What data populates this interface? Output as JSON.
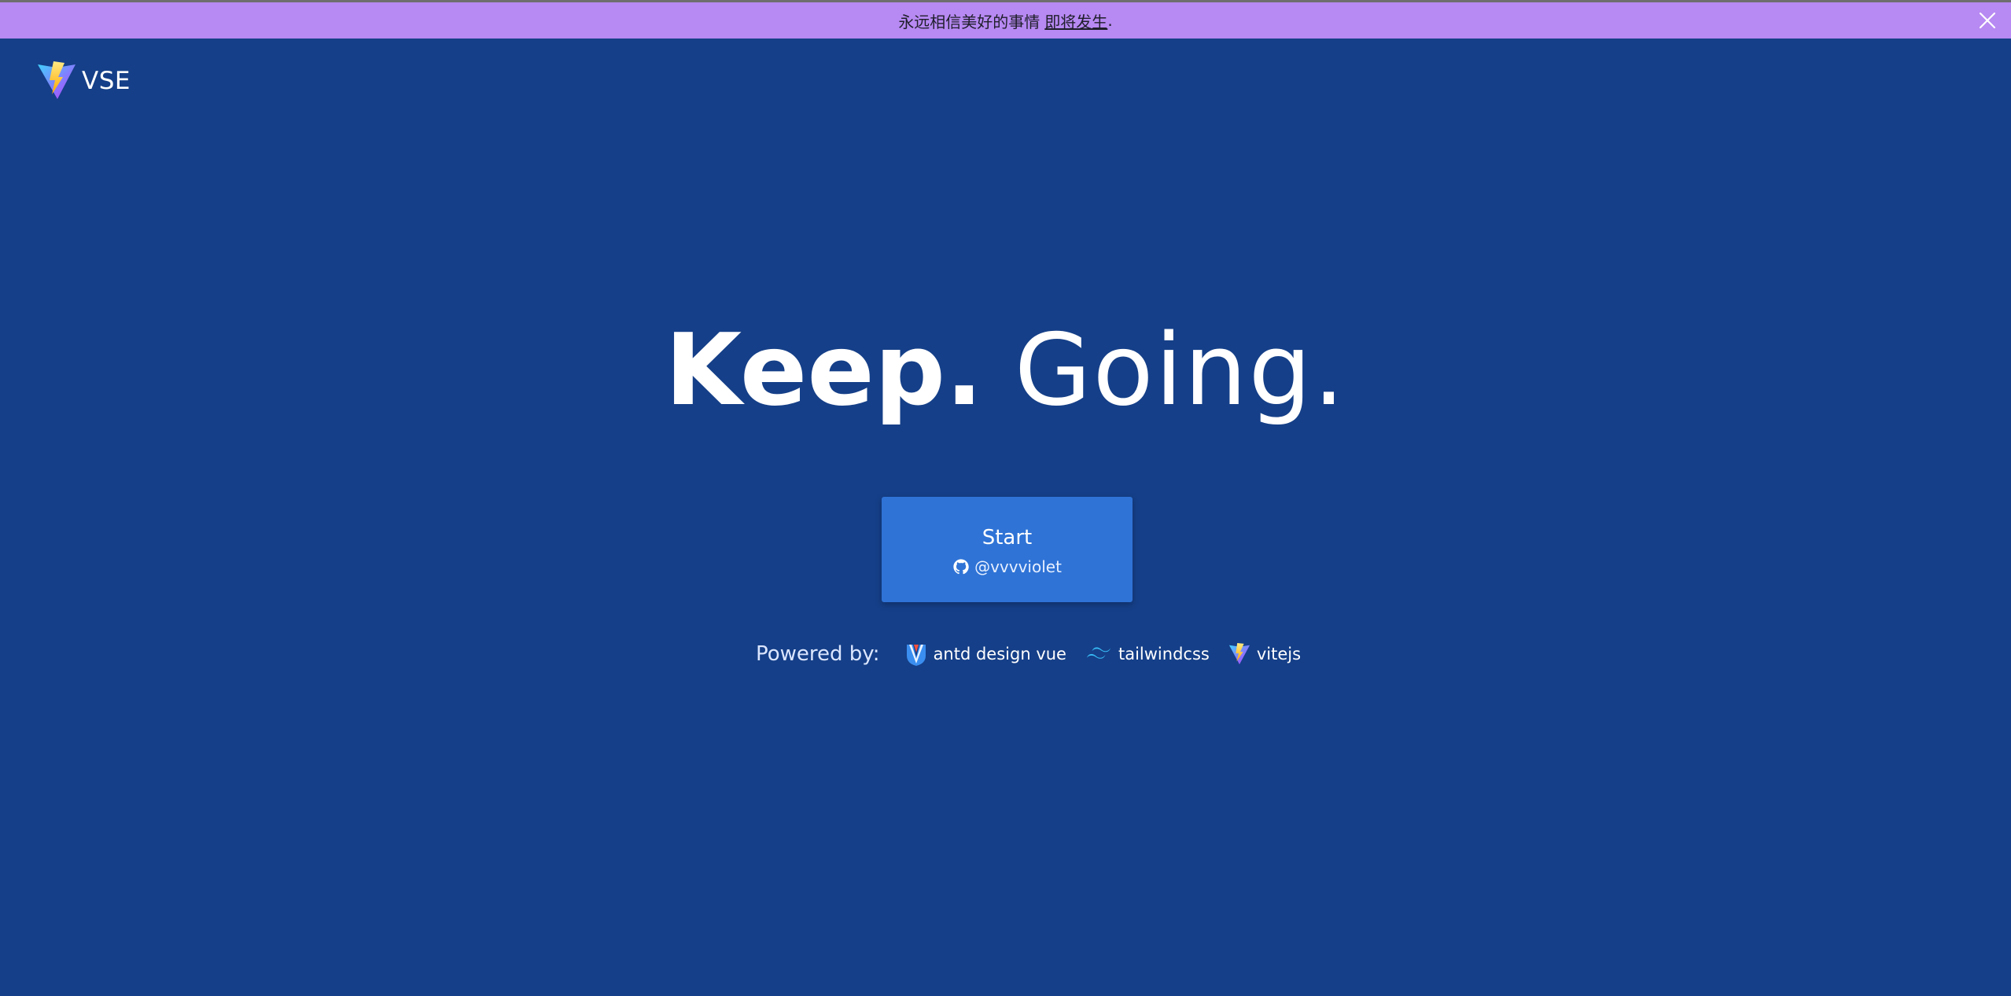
{
  "banner": {
    "message": "永远相信美好的事情",
    "link_text": "即将发生",
    "trailing": "."
  },
  "logo": {
    "text": "VSE",
    "icon": "vite-logo-icon"
  },
  "hero": {
    "bold_word": "Keep.",
    "light_word": "Going."
  },
  "start_button": {
    "label": "Start",
    "handle": "@vvvviolet",
    "icon": "github-icon"
  },
  "powered_by": {
    "label": "Powered by:",
    "items": [
      {
        "label": "antd design vue",
        "icon": "antd-icon"
      },
      {
        "label": "tailwindcss",
        "icon": "tailwind-icon"
      },
      {
        "label": "vitejs",
        "icon": "vite-icon"
      }
    ]
  },
  "colors": {
    "background": "#153f88",
    "banner": "#b789f2",
    "button": "#2f73d6",
    "text": "#ffffff"
  }
}
